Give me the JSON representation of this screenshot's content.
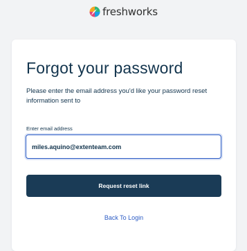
{
  "brand": {
    "name": "freshworks",
    "logo_icon": "freshworks-logo-icon"
  },
  "form": {
    "title": "Forgot your password",
    "description": "Please enter the email address you'd like your password reset information sent to",
    "email_label": "Enter email address",
    "email_value": "miles.aquino@extenteam.com",
    "submit_label": "Request reset link",
    "back_link": "Back To Login"
  },
  "colors": {
    "background": "#f2f3f5",
    "primary_button": "#1a3b56",
    "link": "#2c5cc5",
    "text": "#12344d"
  }
}
